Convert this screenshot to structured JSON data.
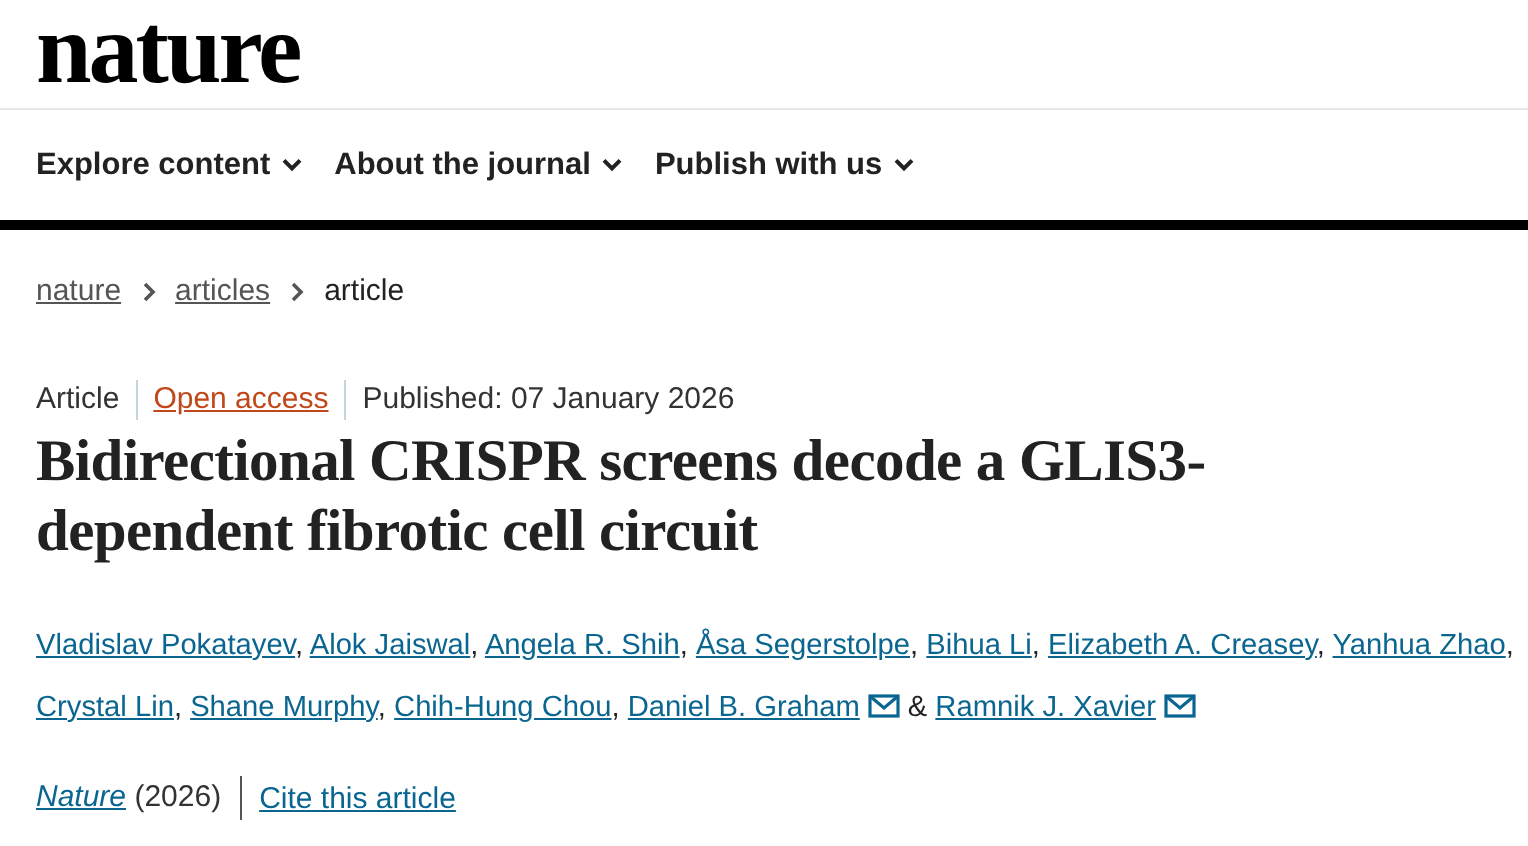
{
  "logo": "nature",
  "nav": [
    {
      "label": "Explore content",
      "dropdown": true
    },
    {
      "label": "About the journal",
      "dropdown": true
    },
    {
      "label": "Publish with us",
      "dropdown": true
    }
  ],
  "breadcrumb": [
    {
      "label": "nature",
      "link": true
    },
    {
      "label": "articles",
      "link": true
    },
    {
      "label": "article",
      "link": false
    }
  ],
  "meta": [
    {
      "kind": "type",
      "text": "Article"
    },
    {
      "kind": "access",
      "text": "Open access"
    },
    {
      "kind": "date",
      "text": "Published: 07 January 2026"
    }
  ],
  "title": "Bidirectional CRISPR screens decode a GLIS3-dependent fibrotic cell circuit",
  "authors": [
    {
      "name": "Vladislav Pokatayev",
      "email": false,
      "separator": ","
    },
    {
      "name": "Alok Jaiswal",
      "email": false,
      "separator": ","
    },
    {
      "name": "Angela R. Shih",
      "email": false,
      "separator": ","
    },
    {
      "name": "Åsa Segerstolpe",
      "email": false,
      "separator": ","
    },
    {
      "name": "Bihua Li",
      "email": false,
      "separator": ","
    },
    {
      "name": "Elizabeth A. Creasey",
      "email": false,
      "separator": ","
    },
    {
      "name": "Yanhua Zhao",
      "email": false,
      "separator": ","
    },
    {
      "name": "Crystal Lin",
      "email": false,
      "separator": ","
    },
    {
      "name": "Shane Murphy",
      "email": false,
      "separator": ","
    },
    {
      "name": "Chih-Hung Chou",
      "email": false,
      "separator": ","
    },
    {
      "name": "Daniel B. Graham",
      "email": true,
      "separator": "&"
    },
    {
      "name": "Ramnik J. Xavier",
      "email": true
    }
  ],
  "citation": {
    "journal": "Nature",
    "year": "(2026)",
    "cite_link": "Cite this article"
  }
}
